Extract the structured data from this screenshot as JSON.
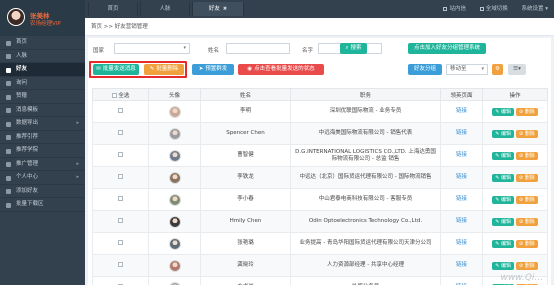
{
  "user": {
    "name": "张美林",
    "role": "农场经理VIP"
  },
  "tabs": [
    {
      "label": "首页"
    },
    {
      "label": "人脉"
    },
    {
      "label": "好友",
      "close": "✖"
    }
  ],
  "topbar": {
    "site_link": "站内信",
    "clear_cache": "全域切换",
    "more": "系统设置"
  },
  "sidebar": [
    {
      "label": "首页",
      "icon": "home-icon"
    },
    {
      "label": "人脉",
      "icon": "people-icon"
    },
    {
      "label": "好友",
      "icon": "friend-icon",
      "active": true
    },
    {
      "label": "询问",
      "icon": "question-icon"
    },
    {
      "label": "赞赠",
      "icon": "gift-icon"
    },
    {
      "label": "消息模板",
      "icon": "template-icon"
    },
    {
      "label": "数据导出",
      "icon": "export-icon",
      "arrow": "▸"
    },
    {
      "label": "推荐引荐",
      "icon": "recommend-icon"
    },
    {
      "label": "推荐学院",
      "icon": "school-icon"
    },
    {
      "label": "推广管理",
      "icon": "promote-icon",
      "arrow": "▸"
    },
    {
      "label": "个人中心",
      "icon": "user-icon",
      "arrow": "▸"
    },
    {
      "label": "添加好友",
      "icon": "add-friend-icon"
    },
    {
      "label": "批量下载区",
      "icon": "download-icon"
    }
  ],
  "breadcrumb": "首页 >> 好友营销管理",
  "filters": {
    "country_label": "国家",
    "name_label": "姓名",
    "company_label": "名字",
    "search_label": "搜索",
    "auto_join_label": "点击加入好友分组管理系统"
  },
  "actions": {
    "batch_send": "批量发送消息",
    "batch_delete": "批量删除",
    "preset_send": "预置群发",
    "click_view": "点击查看批量发送的状态",
    "group_btn": "好友分组",
    "group_select": "移动至",
    "settings_icon": "gear-icon",
    "list_icon": "list-icon"
  },
  "table": {
    "headers": [
      "全选",
      "头像",
      "姓名",
      "职务",
      "领英页面",
      "操作"
    ],
    "edit_label": "编辑",
    "delete_label": "删除",
    "rows": [
      {
        "name": "李明",
        "title": "深圳优联国际物流 - 业务专员",
        "link": "链接",
        "avatar": "#c9a996"
      },
      {
        "name": "Spencer Chen",
        "title": "中远海美国际物流有限公司 - 销售代表",
        "link": "链接",
        "avatar": "#9a9ba0"
      },
      {
        "name": "曹智健",
        "title": "D.G.INTERNATIONAL LOGISTICS CO.,LTD. 上海达勇国际物流有限公司 - 总监 销售",
        "link": "链接",
        "avatar": "#6e7b8c"
      },
      {
        "name": "李铁龙",
        "title": "中远达（北京）国际货运代理有限公司 - 国际物流销售",
        "link": "链接",
        "avatar": "#8a7460"
      },
      {
        "name": "李小春",
        "title": "中山君泰电商科技有限公司 - 客服专员",
        "link": "链接",
        "avatar": "#7e8d73"
      },
      {
        "name": "Hmily Chen",
        "title": "Odin Optoelectronics Technology Co.,Ltd.",
        "link": "链接",
        "avatar": "#3a3a3a"
      },
      {
        "name": "张艳璐",
        "title": "业务提高 - 青岛华阳国际货运代理有限公司天津分公司",
        "link": "链接",
        "avatar": "#5c6a77"
      },
      {
        "name": "龚晓玲",
        "title": "人力资源部经理 - 共享中心经理",
        "link": "链接",
        "avatar": "#b07a6e"
      },
      {
        "name": "方书兰",
        "title": "外贸业务员",
        "link": "链接",
        "avatar": "#9aa7b3"
      }
    ]
  },
  "watermark": "www.Qi..."
}
